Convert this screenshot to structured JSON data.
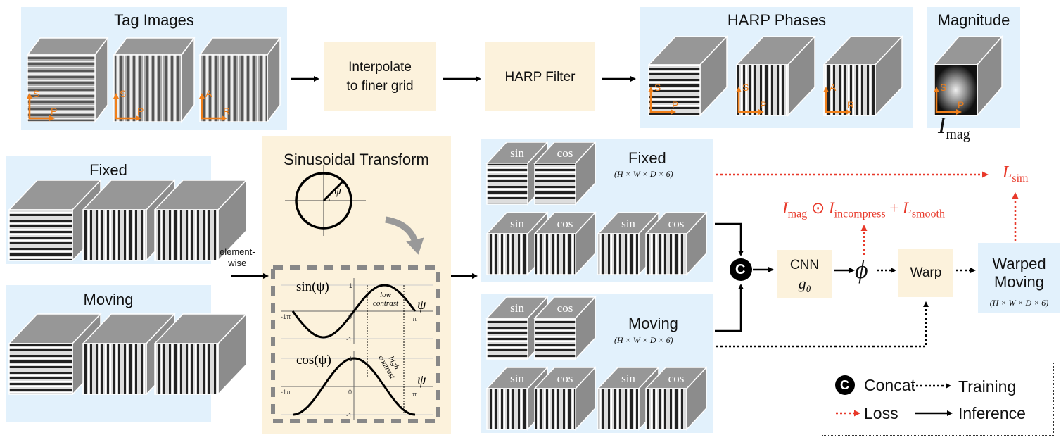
{
  "colors": {
    "panel": "#e2f1fc",
    "process_box": "#fcf2dc",
    "axis_arrows": "#f07f1a",
    "loss": "#e8392a"
  },
  "tag_images": {
    "title": "Tag Images",
    "axes": [
      [
        "S",
        "P"
      ],
      [
        "S",
        "P"
      ],
      [
        "A",
        "R"
      ]
    ]
  },
  "interpolate": {
    "line1": "Interpolate",
    "line2": "to finer grid"
  },
  "harp_filter": {
    "label": "HARP Filter"
  },
  "harp_phases": {
    "title": "HARP Phases",
    "axes": [
      [
        "S",
        "P"
      ],
      [
        "S",
        "P"
      ],
      [
        "A",
        "R"
      ]
    ]
  },
  "magnitude": {
    "title": "Magnitude",
    "axes": [
      "S",
      "P"
    ],
    "symbol": "I",
    "subscript": "mag"
  },
  "fixed_input": {
    "title": "Fixed"
  },
  "moving_input": {
    "title": "Moving"
  },
  "element_wise": {
    "line1": "element-",
    "line2": "wise"
  },
  "sinusoidal": {
    "title": "Sinusoidal Transform",
    "psi": "ψ",
    "sin_label": "sin(ψ)",
    "cos_label": "cos(ψ)",
    "low_contrast": [
      "low",
      "contrast"
    ],
    "high_contrast": [
      "high",
      "contrast"
    ],
    "ticks_x": [
      "-1π",
      "0",
      "π"
    ],
    "ticks_y": [
      "1",
      "-1"
    ]
  },
  "fixed_sincos": {
    "title": "Fixed",
    "shape": "(H × W × D × 6)",
    "labels": [
      "sin",
      "cos",
      "sin",
      "cos",
      "sin",
      "cos"
    ]
  },
  "moving_sincos": {
    "title": "Moving",
    "shape": "(H × W × D × 6)",
    "labels": [
      "sin",
      "cos",
      "sin",
      "cos",
      "sin",
      "cos"
    ]
  },
  "concat_symbol": "C",
  "cnn": {
    "label": "CNN",
    "param": "g",
    "param_sub": "θ"
  },
  "phi": "ϕ",
  "warp": {
    "label": "Warp"
  },
  "warped_moving": {
    "line1": "Warped",
    "line2": "Moving",
    "shape": "(H × W × D × 6)"
  },
  "losses": {
    "sim": {
      "symbol": "L",
      "sub": "sim"
    },
    "reg": {
      "i1": "I",
      "i1_sub": "mag",
      "op": "⊙",
      "i2": "I",
      "i2_sub": "incompress",
      "plus": "+",
      "l": "L",
      "l_sub": "smooth"
    }
  },
  "legend": {
    "concat": "Concat",
    "training": "Training",
    "loss": "Loss",
    "inference": "Inference"
  }
}
